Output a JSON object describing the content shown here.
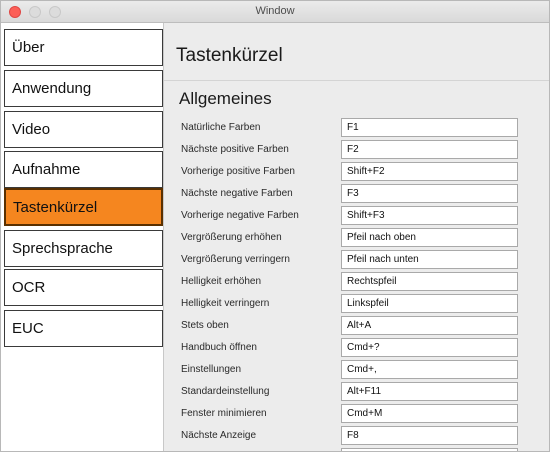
{
  "window": {
    "title": "Window"
  },
  "sidebar": {
    "items": [
      {
        "label": "Über"
      },
      {
        "label": "Anwendung"
      },
      {
        "label": "Video"
      },
      {
        "label": "Aufnahme"
      },
      {
        "label": "Tastenkürzel",
        "active": true
      },
      {
        "label": "Sprechsprache"
      },
      {
        "label": "OCR"
      },
      {
        "label": "EUC"
      }
    ]
  },
  "main": {
    "title": "Tastenkürzel",
    "section": "Allgemeines",
    "shortcuts": [
      {
        "label": "Natürliche Farben",
        "value": "F1"
      },
      {
        "label": "Nächste positive Farben",
        "value": "F2"
      },
      {
        "label": "Vorherige positive Farben",
        "value": "Shift+F2"
      },
      {
        "label": "Nächste negative Farben",
        "value": "F3"
      },
      {
        "label": "Vorherige negative Farben",
        "value": "Shift+F3"
      },
      {
        "label": "Vergrößerung erhöhen",
        "value": "Pfeil nach oben"
      },
      {
        "label": "Vergrößerung verringern",
        "value": "Pfeil nach unten"
      },
      {
        "label": "Helligkeit erhöhen",
        "value": "Rechtspfeil"
      },
      {
        "label": "Helligkeit verringern",
        "value": "Linkspfeil"
      },
      {
        "label": "Stets oben",
        "value": "Alt+A"
      },
      {
        "label": "Handbuch öffnen",
        "value": "Cmd+?"
      },
      {
        "label": "Einstellungen",
        "value": "Cmd+,"
      },
      {
        "label": "Standardeinstellung",
        "value": "Alt+F11"
      },
      {
        "label": "Fenster minimieren",
        "value": "Cmd+M"
      },
      {
        "label": "Nächste Anzeige",
        "value": "F8"
      },
      {
        "label": "",
        "value": ""
      }
    ]
  },
  "colors": {
    "accent": "#f5861f",
    "close": "#fc5f57"
  }
}
